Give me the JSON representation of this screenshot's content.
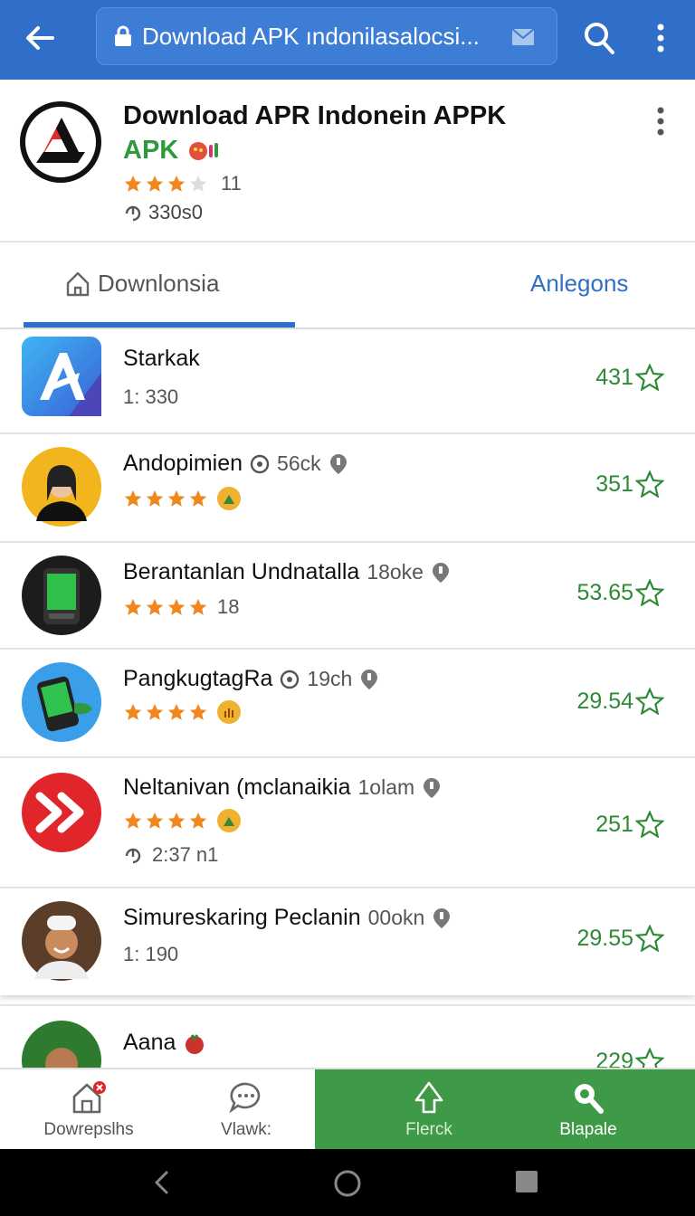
{
  "browser": {
    "url": "Download APK ındonilasalocsi...",
    "colors": {
      "bar": "#2f6fc9",
      "accent_green": "#2e9a3a"
    }
  },
  "app": {
    "title": "Download APR Indonein APPK",
    "subtitle": "APK",
    "rating_count": "11",
    "downloads": "330s0"
  },
  "tabs": [
    {
      "label": "Downlonsia",
      "active": true
    },
    {
      "label": "Anlegons",
      "active": false
    }
  ],
  "items": [
    {
      "name": "Starkak",
      "meta": "",
      "sub": "1: 330",
      "score": "431"
    },
    {
      "name": "Andopimien",
      "meta": "56ck",
      "sub": "",
      "score": "351"
    },
    {
      "name": "Berantanlan Undnatalla",
      "meta": "18oke",
      "sub": "18",
      "score": "53.65"
    },
    {
      "name": "PangkugtagRa",
      "meta": "19ch",
      "sub": "",
      "score": "29.54"
    },
    {
      "name": "Neltanivan (mclanaikia",
      "meta": "1olam",
      "sub": "2:37 n1",
      "score": "251"
    },
    {
      "name": "Simureskaring Peclanin",
      "meta": "00okn",
      "sub": "1: 190",
      "score": "29.55"
    },
    {
      "name": "Aana",
      "meta": "",
      "sub": "",
      "score": "229"
    }
  ],
  "bottom_nav": [
    {
      "label": "Dowrepslhs",
      "icon": "home-icon"
    },
    {
      "label": "Vlawk:",
      "icon": "chat-icon"
    },
    {
      "label": "Flerck",
      "icon": "arrow-up-icon"
    },
    {
      "label": "Blapale",
      "icon": "search-icon"
    }
  ]
}
